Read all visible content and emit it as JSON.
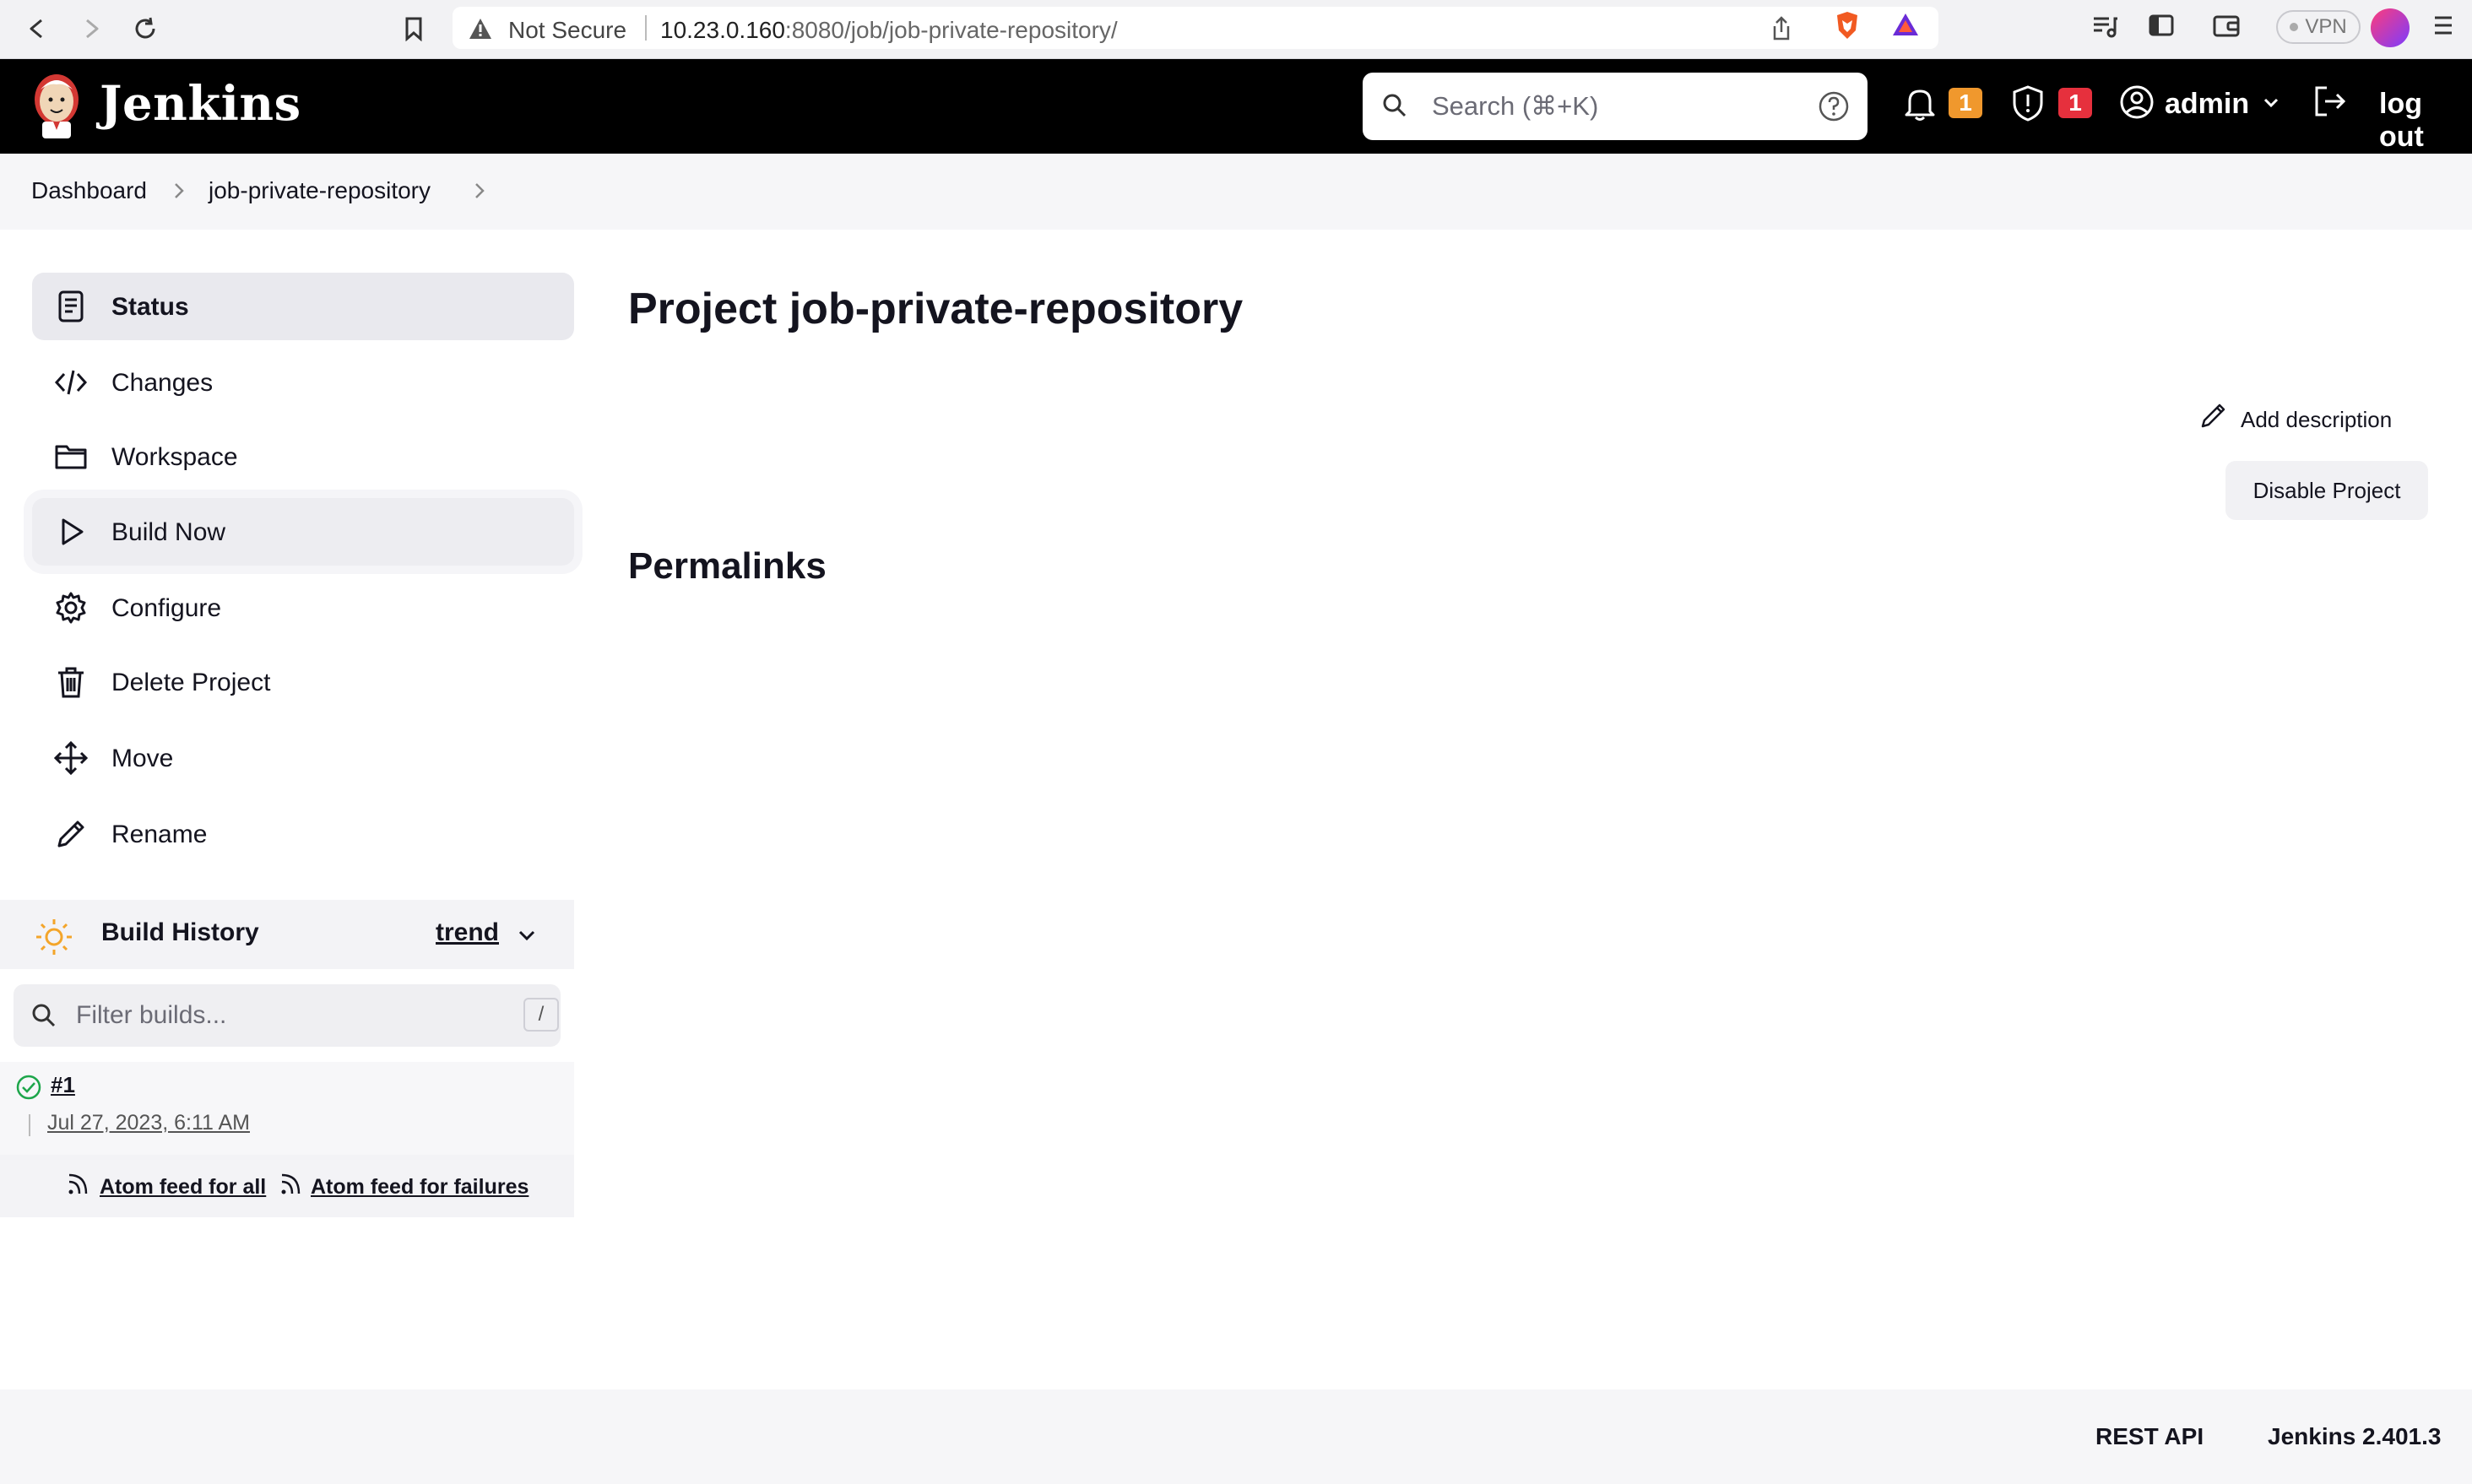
{
  "browser": {
    "security_label": "Not Secure",
    "url_host": "10.23.0.160",
    "url_path": ":8080/job/job-private-repository/",
    "vpn_label": "VPN"
  },
  "header": {
    "app_title": "Jenkins",
    "search_placeholder": "Search (⌘+K)",
    "notifications_count": "1",
    "security_count": "1",
    "user_label": "admin",
    "logout_label": "log out"
  },
  "breadcrumb": {
    "items": [
      "Dashboard",
      "job-private-repository"
    ]
  },
  "sidebar": {
    "tasks": [
      {
        "label": "Status",
        "icon": "status-icon"
      },
      {
        "label": "Changes",
        "icon": "code-icon"
      },
      {
        "label": "Workspace",
        "icon": "folder-icon"
      },
      {
        "label": "Build Now",
        "icon": "play-icon"
      },
      {
        "label": "Configure",
        "icon": "gear-icon"
      },
      {
        "label": "Delete Project",
        "icon": "trash-icon"
      },
      {
        "label": "Move",
        "icon": "move-icon"
      },
      {
        "label": "Rename",
        "icon": "pencil-icon"
      }
    ]
  },
  "build_history": {
    "title": "Build History",
    "trend_label": "trend",
    "filter_placeholder": "Filter builds...",
    "filter_shortcut": "/",
    "builds": [
      {
        "number": "#1",
        "date": "Jul 27, 2023, 6:11 AM",
        "status": "success"
      }
    ],
    "feed_all": "Atom feed for all",
    "feed_failures": "Atom feed for failures"
  },
  "main": {
    "title": "Project job-private-repository",
    "add_description": "Add description",
    "disable_button": "Disable Project",
    "permalinks_title": "Permalinks"
  },
  "footer": {
    "rest_api": "REST API",
    "version": "Jenkins 2.401.3"
  },
  "colors": {
    "header_bg": "#000000",
    "badge_notification": "#f0982d",
    "badge_security": "#e6303d",
    "success": "#1ea64b"
  }
}
